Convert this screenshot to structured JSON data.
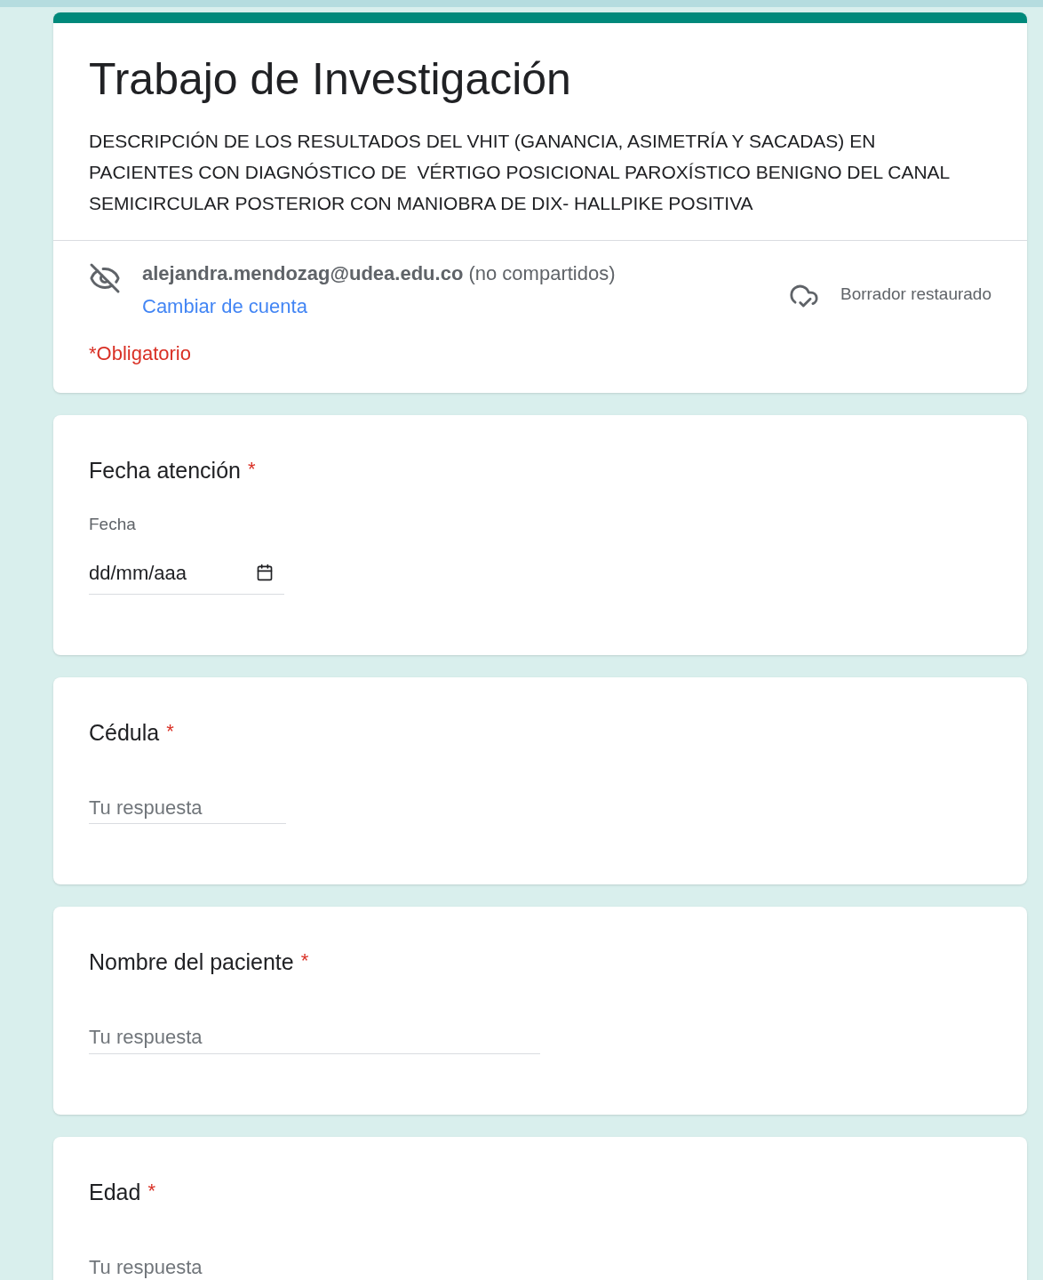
{
  "header": {
    "title": "Trabajo de Investigación",
    "description": "DESCRIPCIÓN DE LOS RESULTADOS DEL VHIT (GANANCIA, ASIMETRÍA Y SACADAS) EN PACIENTES CON DIAGNÓSTICO DE  VÉRTIGO POSICIONAL PAROXÍSTICO BENIGNO DEL CANAL SEMICIRCULAR POSTERIOR CON MANIOBRA DE DIX- HALLPIKE POSITIVA",
    "account": "**alejandra.mendozag@udea.edu.co** (no compartidos)",
    "switch_account": "Cambiar de cuenta",
    "draft_status": "Borrador restaurado",
    "required_note": "*Obligatorio"
  },
  "required_mark": "*",
  "questions": [
    {
      "kind": "date",
      "title": "Fecha atención",
      "required": true,
      "sublabel": "Fecha",
      "placeholder": "dd/mm/aaa"
    },
    {
      "kind": "short_text",
      "title": "Cédula",
      "required": true,
      "placeholder": "Tu respuesta"
    },
    {
      "kind": "long_text",
      "title": "Nombre del paciente",
      "required": true,
      "placeholder": "Tu respuesta"
    },
    {
      "kind": "short_text",
      "title": "Edad",
      "required": true,
      "placeholder": "Tu respuesta"
    }
  ]
}
